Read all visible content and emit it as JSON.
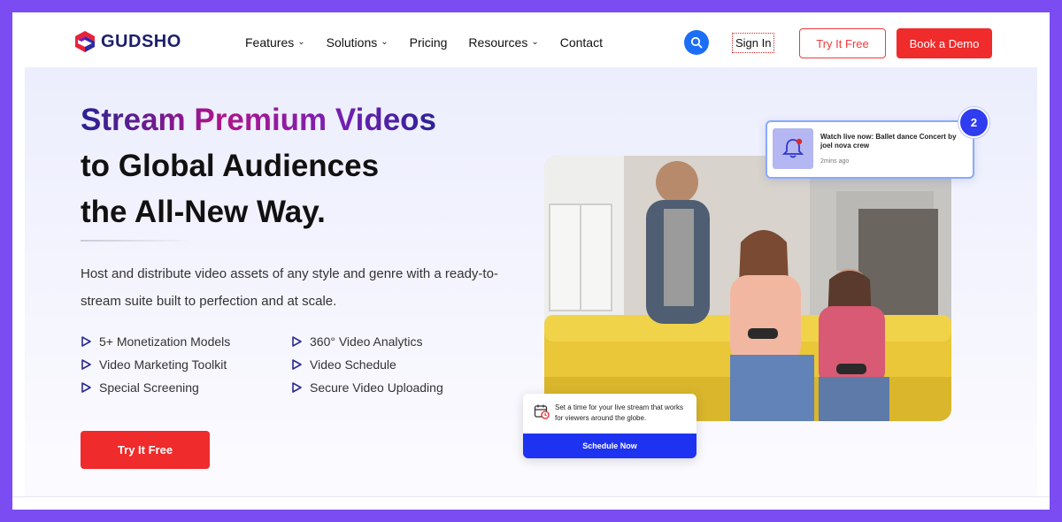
{
  "brand": {
    "name": "GUDSHO"
  },
  "nav": {
    "items": [
      {
        "label": "Features",
        "has_dropdown": true
      },
      {
        "label": "Solutions",
        "has_dropdown": true
      },
      {
        "label": "Pricing",
        "has_dropdown": false
      },
      {
        "label": "Resources",
        "has_dropdown": true
      },
      {
        "label": "Contact",
        "has_dropdown": false
      }
    ],
    "sign_in": "Sign In",
    "try_free": "Try It Free",
    "book_demo": "Book a Demo"
  },
  "hero": {
    "headline_gradient": "Stream Premium Videos",
    "headline_line2": "to Global Audiences",
    "headline_line3": "the All-New Way.",
    "description": "Host and distribute video assets of any style and genre with a ready-to-stream suite built to perfection and at scale.",
    "features": [
      "5+ Monetization Models",
      "360° Video Analytics",
      "Video Marketing Toolkit",
      "Video Schedule",
      "Special Screening",
      "Secure Video Uploading"
    ],
    "cta": "Try It Free"
  },
  "notification": {
    "title": "Watch live now:  Ballet dance Concert by joel nova crew",
    "time": "2mins ago",
    "badge_count": "2"
  },
  "schedule_card": {
    "text": "Set a time for your live stream that works for viewers around the globe.",
    "button": "Schedule Now"
  },
  "colors": {
    "accent_red": "#ef2b2b",
    "accent_blue": "#1b6ef5",
    "frame": "#7a4cf2"
  }
}
